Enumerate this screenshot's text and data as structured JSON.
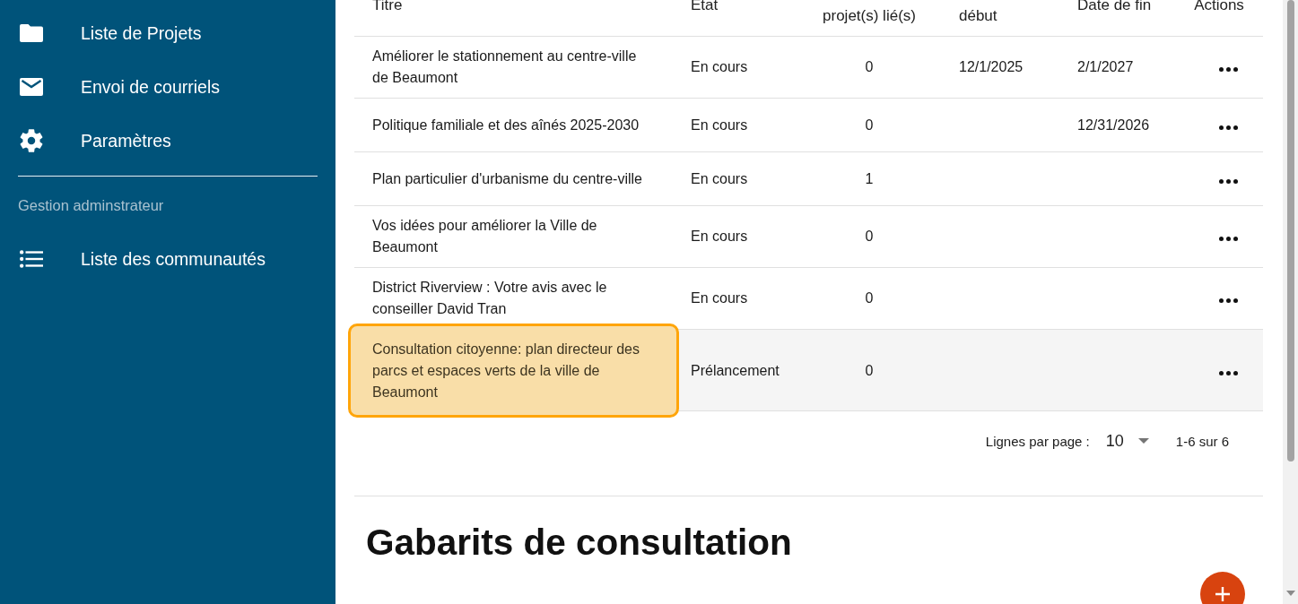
{
  "sidebar": {
    "items": [
      {
        "label": "Liste de Projets"
      },
      {
        "label": "Envoi de courriels"
      },
      {
        "label": "Paramètres"
      }
    ],
    "section": {
      "title": "Gestion adminstrateur",
      "items": [
        {
          "label": "Liste des communautés"
        }
      ]
    }
  },
  "table": {
    "columns": [
      {
        "label": "Titre",
        "kind": "single"
      },
      {
        "label": "Etat",
        "kind": "single"
      },
      {
        "label": "projet(s) lié(s)",
        "kind": "continued"
      },
      {
        "label": "début",
        "kind": "continued"
      },
      {
        "label": "Date de fin",
        "kind": "single"
      },
      {
        "label": "Actions",
        "kind": "single"
      }
    ],
    "rows": [
      {
        "title": "Améliorer le stationnement au centre-ville de Beaumont",
        "status": "En cours",
        "linked": "0",
        "start": "12/1/2025",
        "end": "2/1/2027",
        "selected": false
      },
      {
        "title": "Politique familiale et des aînés 2025-2030",
        "status": "En cours",
        "linked": "0",
        "end": "12/31/2026",
        "selected": false
      },
      {
        "title": "Plan particulier d'urbanisme du centre-ville",
        "status": "En cours",
        "linked": "1",
        "selected": false
      },
      {
        "title": "Vos idées pour améliorer la Ville de Beaumont",
        "status": "En cours",
        "linked": "0",
        "selected": false
      },
      {
        "title": "District Riverview : Votre avis avec le conseiller David Tran",
        "status": "En cours",
        "linked": "0",
        "selected": false
      },
      {
        "title": "Consultation citoyenne: plan directeur des parcs et espaces verts de la ville de Beaumont",
        "status": "Prélancement",
        "linked": "0",
        "selected": true
      }
    ]
  },
  "pagination": {
    "rows_per_page_label": "Lignes par page :",
    "rows_per_page": "10",
    "range": "1-6 sur 6"
  },
  "templates": {
    "title": "Gabarits de consultation"
  }
}
